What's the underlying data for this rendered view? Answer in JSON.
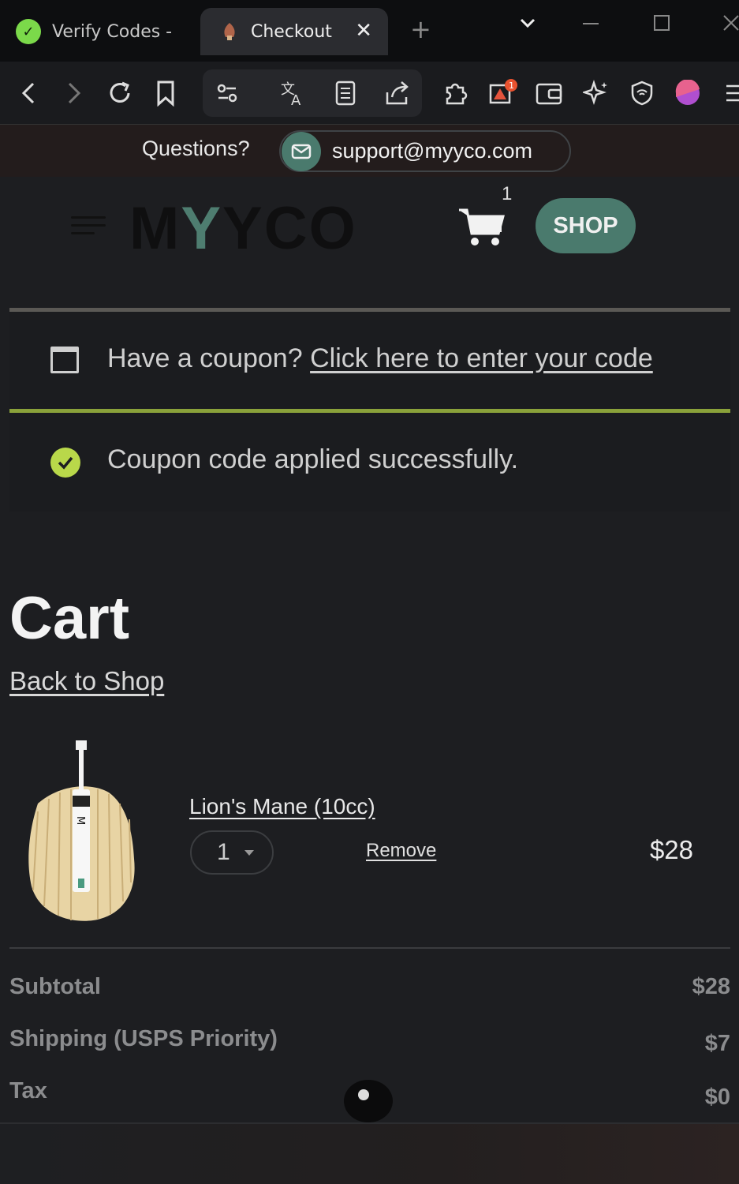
{
  "browser": {
    "tabs": [
      {
        "title": "Verify Codes -",
        "favicon": "verify-codes-favicon",
        "active": false
      },
      {
        "title": "Checkout",
        "favicon": "mushroom-favicon",
        "active": true
      }
    ],
    "extension_badge": "1"
  },
  "topbar": {
    "questions": "Questions?",
    "support_email": "support@myyco.com"
  },
  "header": {
    "logo_pre": "M",
    "logo_y": "Y",
    "logo_post": "YCO",
    "logo_first_m": "M",
    "cart_count": "1",
    "shop_button": "SHOP"
  },
  "coupon": {
    "prompt": "Have a coupon?",
    "link": "Click here to enter your code",
    "success": "Coupon code applied successfully."
  },
  "cart": {
    "title": "Cart",
    "back_link": "Back to Shop",
    "items": [
      {
        "name": "Lion's Mane (10cc)",
        "quantity": "1",
        "remove": "Remove",
        "price": "$28"
      }
    ]
  },
  "summary": {
    "rows": [
      {
        "label": "Subtotal",
        "value": "$28"
      },
      {
        "label": "Shipping (USPS Priority)",
        "value": "$7"
      },
      {
        "label": "Tax",
        "value": "$0"
      }
    ]
  },
  "colors": {
    "accent_teal": "#4a7a6d",
    "success_green": "#b9d84a",
    "notice_border_green": "#8aa13a"
  }
}
